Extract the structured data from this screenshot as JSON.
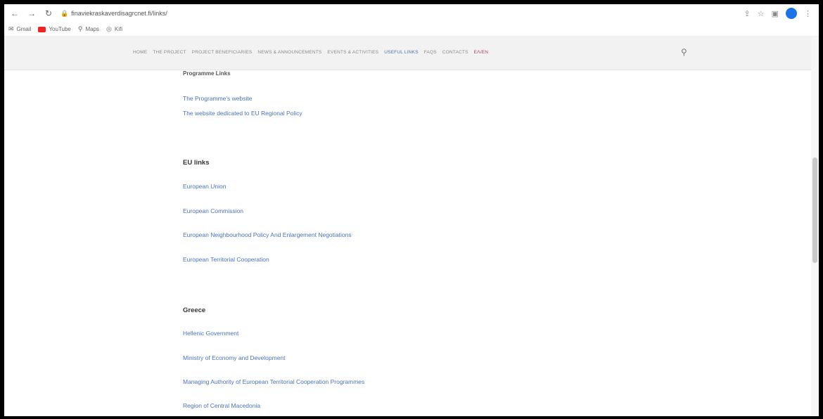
{
  "browser": {
    "url": "finaviekraskaverdisagrcnet.fi/links/",
    "bookmarks": [
      "Gmail",
      "YouTube",
      "Maps",
      "Kifi"
    ]
  },
  "site": {
    "nav": [
      "HOME",
      "THE PROJECT",
      "PROJECT BENEFICIARIES",
      "NEWS & ANNOUNCEMENTS",
      "EVENTS & ACTIVITIES",
      "USEFUL LINKS",
      "FAQS",
      "CONTACTS",
      "ΕΛ/EN"
    ],
    "active_nav": "USEFUL LINKS"
  },
  "content": {
    "partial_heading": "Programme Links",
    "programme_links": [
      "The Programme's website",
      "The website dedicated to EU Regional Policy"
    ],
    "eu_heading": "EU links",
    "eu_links": [
      "European Union",
      "European Commission",
      "European Neighbourhood Policy And Enlargement Negotiations",
      "European Territorial Cooperation"
    ],
    "greece_heading": "Greece",
    "greece_links": [
      "Hellenic Government",
      "Ministry of Economy and Development",
      "Managing Authority of European Territorial Cooperation Programmes",
      "Region of Central Macedonia"
    ]
  },
  "colors": {
    "link": "#4a72b8",
    "active_nav": "#4e6fb4",
    "nav_bg": "#f2f2f2"
  }
}
